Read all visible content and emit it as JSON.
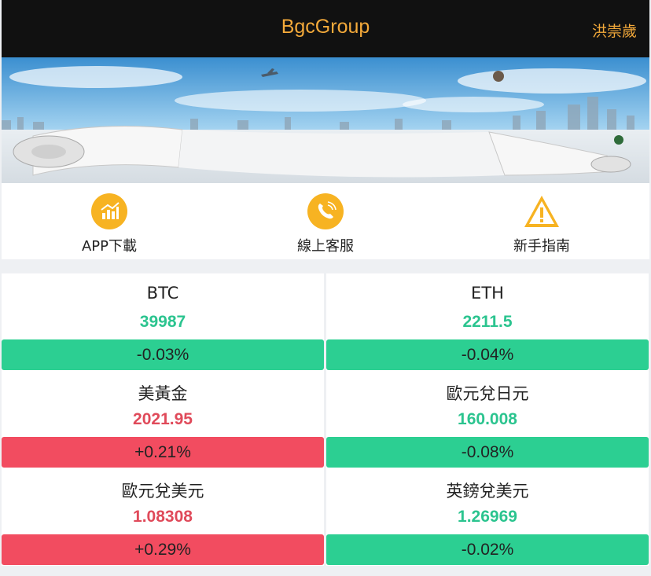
{
  "header": {
    "title": "BgcGroup",
    "user": "洪崇歲"
  },
  "colors": {
    "accent": "#f3a93a",
    "up": "#f24c60",
    "down": "#2ccf92"
  },
  "nav": [
    {
      "label": "APP下載",
      "icon": "chart-icon"
    },
    {
      "label": "線上客服",
      "icon": "phone-icon"
    },
    {
      "label": "新手指南",
      "icon": "warning-icon"
    }
  ],
  "markets": [
    {
      "name": "BTC",
      "price": "39987",
      "change": "-0.03%",
      "trend": "down"
    },
    {
      "name": "ETH",
      "price": "2211.5",
      "change": "-0.04%",
      "trend": "down"
    },
    {
      "name": "美黃金",
      "price": "2021.95",
      "change": "+0.21%",
      "trend": "up"
    },
    {
      "name": "歐元兌日元",
      "price": "160.008",
      "change": "-0.08%",
      "trend": "down"
    },
    {
      "name": "歐元兌美元",
      "price": "1.08308",
      "change": "+0.29%",
      "trend": "up"
    },
    {
      "name": "英鎊兌美元",
      "price": "1.26969",
      "change": "-0.02%",
      "trend": "down"
    }
  ]
}
